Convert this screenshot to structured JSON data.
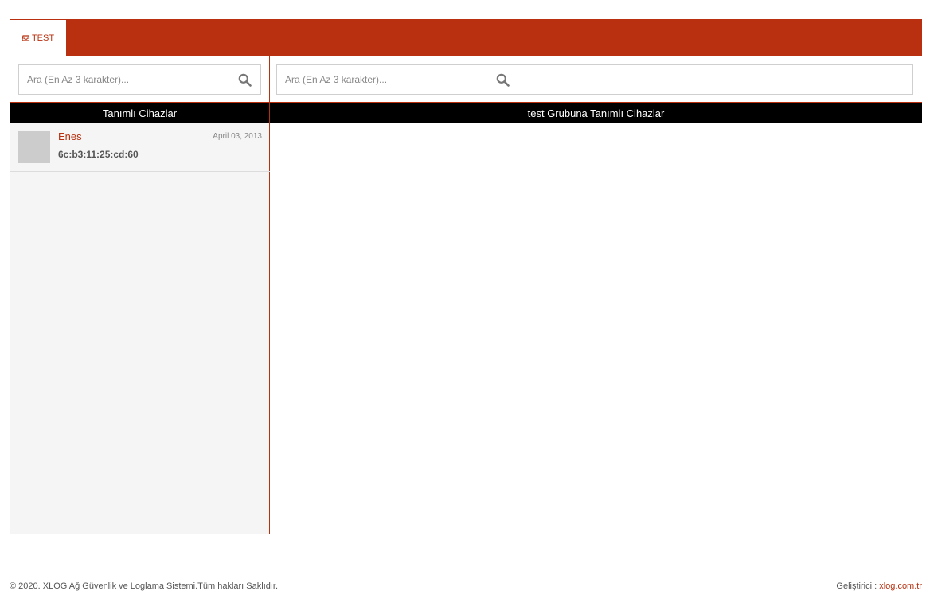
{
  "tab": {
    "label": "TEST",
    "icon": "inbox-icon"
  },
  "left": {
    "search_placeholder": "Ara (En Az 3 karakter)...",
    "header": "Tanımlı Cihazlar",
    "devices": [
      {
        "name": "Enes",
        "mac": "6c:b3:11:25:cd:60",
        "date": "April 03, 2013"
      }
    ]
  },
  "right": {
    "search_placeholder": "Ara (En Az 3 karakter)...",
    "header": "test Grubuna Tanımlı Cihazlar"
  },
  "footer": {
    "copyright": "© 2020. XLOG Ağ Güvenlik ve Loglama Sistemi.Tüm hakları Saklıdır.",
    "dev_label": "Geliştirici : ",
    "dev_link": "xlog.com.tr"
  },
  "colors": {
    "accent": "#b8300f",
    "header_bg": "#000000",
    "panel_bg": "#f5f5f5"
  }
}
